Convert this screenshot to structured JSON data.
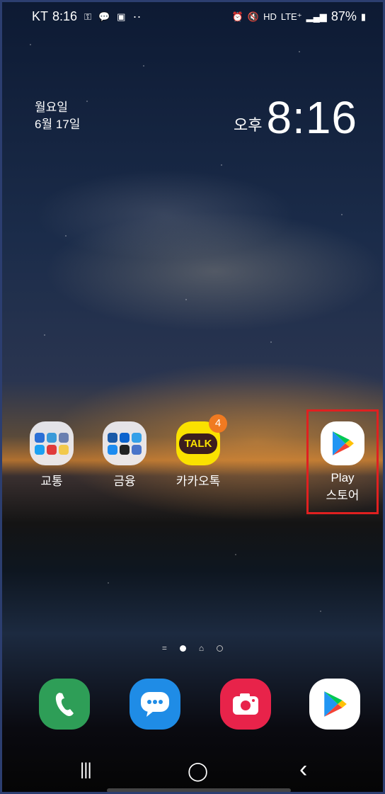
{
  "status_bar": {
    "carrier": "KT",
    "time": "8:16",
    "left_icons": [
      "key-icon",
      "talk-icon",
      "gallery-icon"
    ],
    "more": "··",
    "right_icons": [
      "alarm-icon",
      "mute-icon",
      "hd-icon"
    ],
    "network": "LTE⁺",
    "battery": "87%"
  },
  "clock_widget": {
    "weekday": "월요일",
    "date": "6월 17일",
    "ampm": "오후",
    "time": "8:16"
  },
  "apps": [
    {
      "label": "교통",
      "icon": "folder-transport"
    },
    {
      "label": "금융",
      "icon": "folder-finance"
    },
    {
      "label": "카카오톡",
      "icon": "kakaotalk-icon",
      "badge": "4",
      "icon_text": "TALK"
    },
    {
      "label_line1": "Play",
      "label_line2": "스토어",
      "icon": "play-store-icon"
    }
  ],
  "dock": [
    "phone-icon",
    "messages-icon",
    "camera-icon",
    "play-store-icon"
  ],
  "nav": {
    "recents": "|||",
    "home": "◯",
    "back": "‹"
  },
  "colors": {
    "highlight": "#e02020",
    "badge": "#f07a21",
    "kakao": "#fae100"
  }
}
